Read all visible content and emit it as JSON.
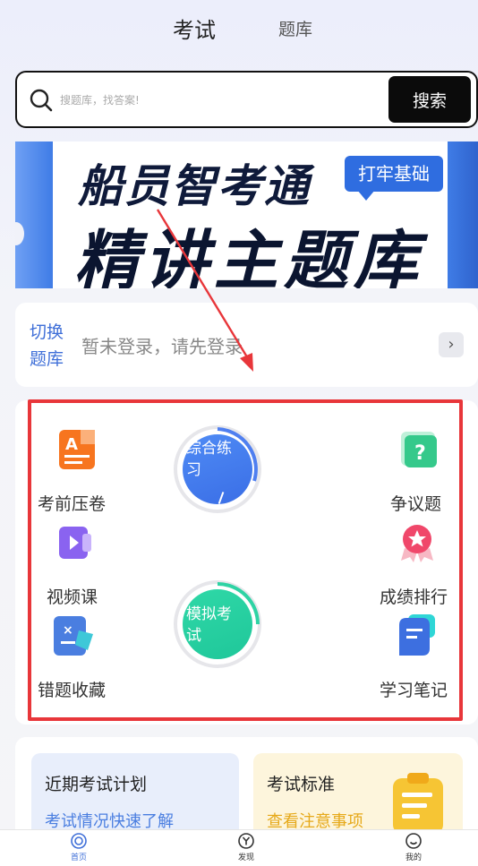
{
  "top_tabs": {
    "active": "考试",
    "inactive": "题库"
  },
  "search": {
    "placeholder": "搜题库，找答案!",
    "button_label": "搜索"
  },
  "banner": {
    "line1": "船员智考通",
    "tag": "打牢基础",
    "line2": "精讲主题库"
  },
  "login": {
    "switch_label": "切换题库",
    "message": "暂未登录，请先登录",
    "arrow": "›"
  },
  "features": {
    "exam_pressure": "考前压卷",
    "comprehensive_practice": "综合练习",
    "disputed_questions": "争议题",
    "video_course": "视频课",
    "score_ranking": "成绩排行",
    "mock_exam": "模拟考试",
    "wrong_collection": "错题收藏",
    "study_notes": "学习笔记"
  },
  "cards": {
    "plan": {
      "title": "近期考试计划",
      "subtitle": "考试情况快速了解"
    },
    "standard": {
      "title": "考试标准",
      "subtitle": "查看注意事项"
    }
  },
  "bottom_nav": [
    {
      "label": "首页",
      "icon": "home-icon",
      "active": true
    },
    {
      "label": "发现",
      "icon": "discover-icon",
      "active": false
    },
    {
      "label": "我的",
      "icon": "profile-icon",
      "active": false
    }
  ],
  "colors": {
    "accent_blue": "#3f6fd8",
    "annotation_red": "#e8363a",
    "mock_green": "#2ed3a4",
    "practice_blue": "#4f7ff0"
  }
}
